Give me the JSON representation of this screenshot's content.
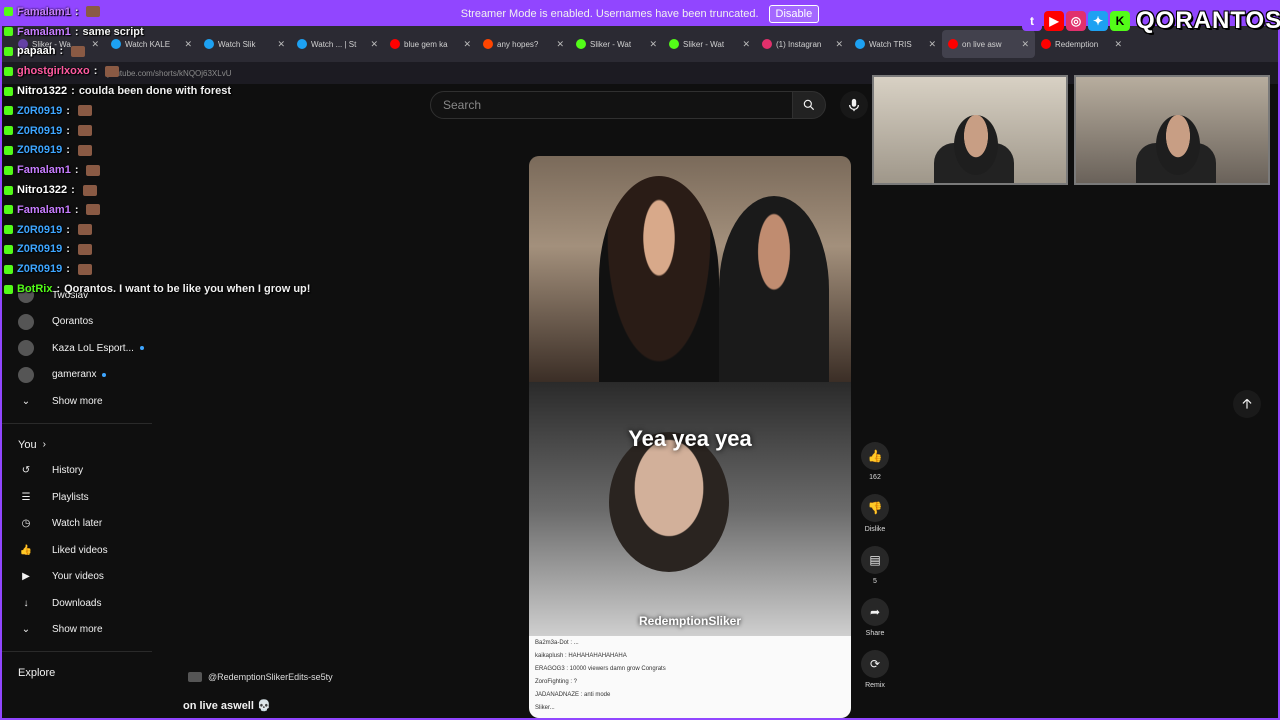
{
  "streamer_bar": {
    "message": "Streamer Mode is enabled. Usernames have been truncated.",
    "button": "Disable"
  },
  "tabs": [
    {
      "label": "Sliker - Wa",
      "color": "#6441a5"
    },
    {
      "label": "Watch KALE",
      "color": "#1da1f2"
    },
    {
      "label": "Watch Slik",
      "color": "#1da1f2"
    },
    {
      "label": "Watch ... | St",
      "color": "#1da1f2"
    },
    {
      "label": "blue gem ka",
      "color": "#ff0000"
    },
    {
      "label": "any hopes?",
      "color": "#ff4500"
    },
    {
      "label": "Sliker - Wat",
      "color": "#53fc18"
    },
    {
      "label": "Sliker - Wat",
      "color": "#53fc18"
    },
    {
      "label": "(1) Instagran",
      "color": "#e1306c"
    },
    {
      "label": "Watch TRIS",
      "color": "#1da1f2"
    },
    {
      "label": "on live asw",
      "color": "#ff0000",
      "active": true
    },
    {
      "label": "Redemption",
      "color": "#ff0000"
    }
  ],
  "address_bar": {
    "url": "youtube.com/shorts/kNQOj63XLvU"
  },
  "search": {
    "placeholder": "Search"
  },
  "chat": [
    {
      "user": "Famalam1",
      "text": "",
      "color": "#c77dff"
    },
    {
      "user": "Famalam1",
      "text": "same script",
      "color": "#c77dff"
    },
    {
      "user": "papaah",
      "text": "",
      "color": "#ffffff"
    },
    {
      "user": "ghostgirlxoxo",
      "text": "",
      "color": "#ff5aa0"
    },
    {
      "user": "Nitro1322",
      "text": "coulda been done with forest",
      "color": "#ffffff"
    },
    {
      "user": "Z0R0919",
      "text": "",
      "color": "#3ea6ff"
    },
    {
      "user": "Z0R0919",
      "text": "",
      "color": "#3ea6ff"
    },
    {
      "user": "Z0R0919",
      "text": "",
      "color": "#3ea6ff"
    },
    {
      "user": "Famalam1",
      "text": "",
      "color": "#c77dff"
    },
    {
      "user": "Nitro1322",
      "text": "",
      "color": "#ffffff"
    },
    {
      "user": "Famalam1",
      "text": "",
      "color": "#c77dff"
    },
    {
      "user": "Z0R0919",
      "text": "",
      "color": "#3ea6ff"
    },
    {
      "user": "Z0R0919",
      "text": "",
      "color": "#3ea6ff"
    },
    {
      "user": "Z0R0919",
      "text": "",
      "color": "#3ea6ff"
    },
    {
      "user": "BotRix",
      "text": "Qorantos. I want to be like you when I grow up!",
      "color": "#53fc18"
    }
  ],
  "sidebar": {
    "subscriptions": [
      {
        "label": "Twoslav",
        "dot": false
      },
      {
        "label": "Qorantos",
        "dot": false
      },
      {
        "label": "Kaza LoL Esport...",
        "dot": true
      },
      {
        "label": "gameranx",
        "dot": true
      }
    ],
    "show_more": "Show more",
    "you_header": "You",
    "you_items": [
      {
        "label": "History",
        "icon": "history-icon"
      },
      {
        "label": "Playlists",
        "icon": "playlists-icon"
      },
      {
        "label": "Watch later",
        "icon": "clock-icon"
      },
      {
        "label": "Liked videos",
        "icon": "thumbs-up-icon"
      },
      {
        "label": "Your videos",
        "icon": "video-icon"
      },
      {
        "label": "Downloads",
        "icon": "download-icon"
      }
    ],
    "show_more_2": "Show more",
    "explore": "Explore"
  },
  "video": {
    "caption_overlay": "Yea yea yea",
    "watermark": "RedemptionSliker",
    "channel": "@RedemptionSlikerEdits-se5ty",
    "title": "on live aswell 💀",
    "inner_chat": [
      "Ba2m3a-Dot : ...",
      "kaikaplush : HAHAHAHAHAHAHA",
      "ERAGOG3 : 10000 viewers damn grow Congrats",
      "ZoroFighting : ?",
      "JADANADNAZE : anti mode",
      "Sliker..."
    ]
  },
  "actions": [
    {
      "icon": "thumbs-up-icon",
      "label": "162"
    },
    {
      "icon": "thumbs-down-icon",
      "label": "Dislike"
    },
    {
      "icon": "comment-icon",
      "label": "5"
    },
    {
      "icon": "share-icon",
      "label": "Share"
    },
    {
      "icon": "remix-icon",
      "label": "Remix"
    }
  ],
  "logo": {
    "text": "QORANTOS"
  }
}
